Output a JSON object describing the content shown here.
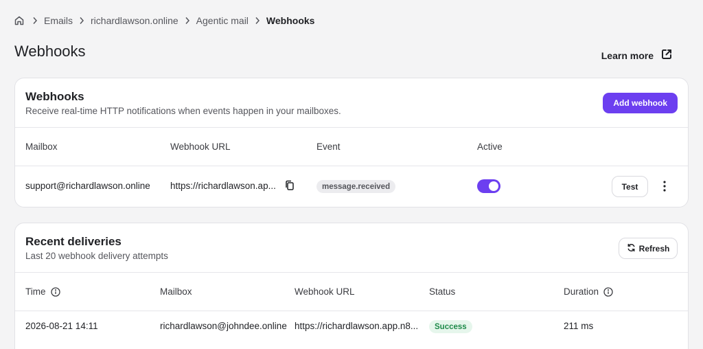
{
  "breadcrumb": {
    "items": [
      "Emails",
      "richardlawson.online",
      "Agentic mail"
    ],
    "current": "Webhooks"
  },
  "page": {
    "title": "Webhooks",
    "learn_more": "Learn more"
  },
  "webhooks_card": {
    "title": "Webhooks",
    "subtitle": "Receive real-time HTTP notifications when events happen in your mailboxes.",
    "add_button": "Add webhook",
    "columns": [
      "Mailbox",
      "Webhook URL",
      "Event",
      "Active"
    ],
    "rows": [
      {
        "mailbox": "support@richardlawson.online",
        "url": "https://richardlawson.ap...",
        "event": "message.received",
        "active": true,
        "test_label": "Test"
      }
    ]
  },
  "deliveries_card": {
    "title": "Recent deliveries",
    "subtitle": "Last 20 webhook delivery attempts",
    "refresh_button": "Refresh",
    "columns": [
      "Time",
      "Mailbox",
      "Webhook URL",
      "Status",
      "Duration"
    ],
    "rows": [
      {
        "time": "2026-08-21 14:11",
        "mailbox": "richardlawson@johndee.online",
        "url": "https://richardlawson.app.n8...",
        "status": "Success",
        "duration": "211 ms"
      }
    ]
  },
  "colors": {
    "accent": "#6c3ff0",
    "success_bg": "#e6f6ec",
    "success_text": "#1e8a4a",
    "background": "#f4f4f5"
  },
  "icons": [
    "home-icon",
    "chevron-right-icon",
    "external-link-icon",
    "copy-icon",
    "more-vertical-icon",
    "refresh-icon",
    "info-icon"
  ]
}
